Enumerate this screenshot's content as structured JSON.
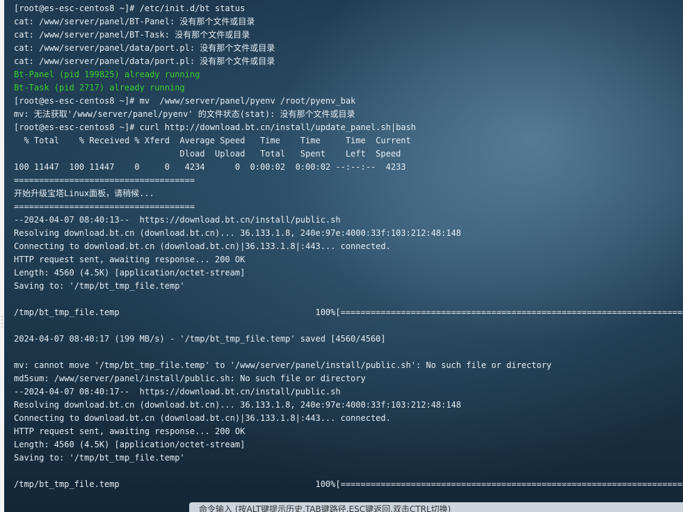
{
  "terminal": {
    "lines": [
      {
        "text": "[root@es-esc-centos8 ~]# /etc/init.d/bt status",
        "color": "default"
      },
      {
        "text": "cat: /www/server/panel/BT-Panel: 没有那个文件或目录",
        "color": "default"
      },
      {
        "text": "cat: /www/server/panel/BT-Task: 没有那个文件或目录",
        "color": "default"
      },
      {
        "text": "cat: /www/server/panel/data/port.pl: 没有那个文件或目录",
        "color": "default"
      },
      {
        "text": "cat: /www/server/panel/data/port.pl: 没有那个文件或目录",
        "color": "default"
      },
      {
        "text": "Bt-Panel (pid 199825) already running",
        "color": "green"
      },
      {
        "text": "Bt-Task (pid 2717) already running",
        "color": "green"
      },
      {
        "text": "[root@es-esc-centos8 ~]# mv  /www/server/panel/pyenv /root/pyenv_bak",
        "color": "default"
      },
      {
        "text": "mv: 无法获取'/www/server/panel/pyenv' 的文件状态(stat): 没有那个文件或目录",
        "color": "default"
      },
      {
        "text": "[root@es-esc-centos8 ~]# curl http://download.bt.cn/install/update_panel.sh|bash",
        "color": "default"
      },
      {
        "text": "  % Total    % Received % Xferd  Average Speed   Time    Time     Time  Current",
        "color": "default"
      },
      {
        "text": "                                 Dload  Upload   Total   Spent    Left  Speed",
        "color": "default"
      },
      {
        "text": "100 11447  100 11447    0     0   4234      0  0:00:02  0:00:02 --:--:--  4233",
        "color": "default"
      },
      {
        "text": "====================================",
        "color": "default"
      },
      {
        "text": "开始升级宝塔Linux面板，请稍候...",
        "color": "default"
      },
      {
        "text": "====================================",
        "color": "default"
      },
      {
        "text": "--2024-04-07 08:40:13--  https://download.bt.cn/install/public.sh",
        "color": "default"
      },
      {
        "text": "Resolving download.bt.cn (download.bt.cn)... 36.133.1.8, 240e:97e:4000:33f:103:212:48:148",
        "color": "default"
      },
      {
        "text": "Connecting to download.bt.cn (download.bt.cn)|36.133.1.8|:443... connected.",
        "color": "default"
      },
      {
        "text": "HTTP request sent, awaiting response... 200 OK",
        "color": "default"
      },
      {
        "text": "Length: 4560 (4.5K) [application/octet-stream]",
        "color": "default"
      },
      {
        "text": "Saving to: '/tmp/bt_tmp_file.temp'",
        "color": "default"
      },
      {
        "text": "",
        "color": "default"
      },
      {
        "text": "/tmp/bt_tmp_file.temp                                       100%[===========================================================================",
        "color": "default"
      },
      {
        "text": "",
        "color": "default"
      },
      {
        "text": "2024-04-07 08:40:17 (199 MB/s) - '/tmp/bt_tmp_file.temp' saved [4560/4560]",
        "color": "default"
      },
      {
        "text": "",
        "color": "default"
      },
      {
        "text": "mv: cannot move '/tmp/bt_tmp_file.temp' to '/www/server/panel/install/public.sh': No such file or directory",
        "color": "default"
      },
      {
        "text": "md5sum: /www/server/panel/install/public.sh: No such file or directory",
        "color": "default"
      },
      {
        "text": "--2024-04-07 08:40:17--  https://download.bt.cn/install/public.sh",
        "color": "default"
      },
      {
        "text": "Resolving download.bt.cn (download.bt.cn)... 36.133.1.8, 240e:97e:4000:33f:103:212:48:148",
        "color": "default"
      },
      {
        "text": "Connecting to download.bt.cn (download.bt.cn)|36.133.1.8|:443... connected.",
        "color": "default"
      },
      {
        "text": "HTTP request sent, awaiting response... 200 OK",
        "color": "default"
      },
      {
        "text": "Length: 4560 (4.5K) [application/octet-stream]",
        "color": "default"
      },
      {
        "text": "Saving to: '/tmp/bt_tmp_file.temp'",
        "color": "default"
      },
      {
        "text": "",
        "color": "default"
      },
      {
        "text": "/tmp/bt_tmp_file.temp                                       100%[===========================================================================",
        "color": "default"
      }
    ]
  },
  "command_bar": {
    "text": "命令输入 (按ALT键提示历史,TAB键路径,ESC键返回,双击CTRL切换)"
  },
  "colors": {
    "text": "#e6eef4",
    "green": "#39d12b",
    "background": "#1f3a50"
  }
}
